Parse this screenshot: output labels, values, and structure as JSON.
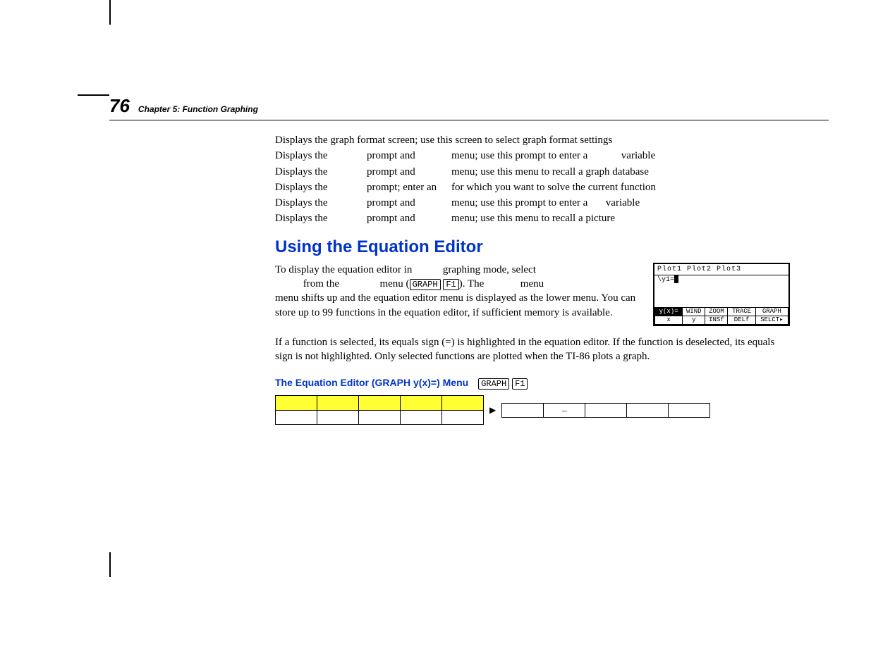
{
  "page": {
    "number": "76",
    "chapter": "Chapter 5:  Function Graphing"
  },
  "table_rows": [
    {
      "c1": "Displays the graph format screen; use this screen to select graph format settings",
      "full": true
    },
    {
      "c1": "Displays the",
      "c2": "prompt and",
      "c3": "menu; use this prompt to enter a",
      "c4": "variable"
    },
    {
      "c1": "Displays the",
      "c2": "prompt and",
      "c3": "menu; use this menu to recall a graph database"
    },
    {
      "c1": "Displays the",
      "c2": "prompt; enter an",
      "c3": "for which you want to solve the current function"
    },
    {
      "c1": "Displays the",
      "c2": "prompt and",
      "c3": "menu; use this prompt to enter a",
      "c4": "variable"
    },
    {
      "c1": "Displays the",
      "c2": "prompt and",
      "c3": "menu; use this menu to recall a picture"
    }
  ],
  "section": {
    "heading": "Using the Equation Editor",
    "para1a": "To display the equation editor in",
    "para1b": "graphing mode, select",
    "para1c": "from the",
    "para1d": "menu (",
    "key_graph": "GRAPH",
    "key_f1": "F1",
    "para1e": "). The",
    "para1f": "menu shifts up and the equation editor menu is displayed as the lower menu. You can store up to 99 functions in the equation editor, if sufficient memory is available.",
    "para2": "If a function is selected, its equals sign (=) is highlighted in the equation editor. If the function is deselected, its equals sign is not highlighted. Only selected functions are plotted when the TI-86 plots a graph."
  },
  "calc": {
    "top": "Plot1  Plot2  Plot3",
    "body": "\\y1=█",
    "menu_top": [
      "y(x)=",
      "WIND",
      "ZOOM",
      "TRACE",
      "GRAPH"
    ],
    "menu_bot": [
      "x",
      "y",
      "INSf",
      "DELf",
      "SELCT▸"
    ]
  },
  "submenu": {
    "heading": "The Equation Editor (GRAPH y(x)=) Menu",
    "key_graph": "GRAPH",
    "key_f1": "F1",
    "right_row": [
      "",
      "–",
      "",
      "",
      ""
    ]
  }
}
